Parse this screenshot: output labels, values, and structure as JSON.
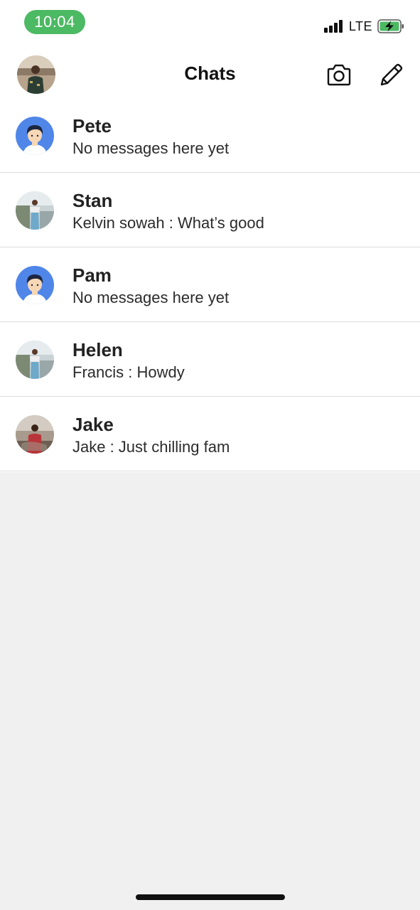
{
  "status_bar": {
    "time": "10:04",
    "network": "LTE",
    "time_pill_color": "#4cb963",
    "battery_color": "#4cb963"
  },
  "header": {
    "title": "Chats",
    "camera_icon": "camera-icon",
    "compose_icon": "pencil-icon"
  },
  "chats": [
    {
      "name": "Pete",
      "preview": "No messages here yet",
      "avatar": "default-avatar"
    },
    {
      "name": "Stan",
      "preview": "Kelvin sowah : What’s good",
      "avatar": "photo-avatar"
    },
    {
      "name": "Pam",
      "preview": "No messages here yet",
      "avatar": "default-avatar"
    },
    {
      "name": "Helen",
      "preview": "Francis : Howdy",
      "avatar": "photo-avatar"
    },
    {
      "name": "Jake",
      "preview": "Jake : Just chilling fam",
      "avatar": "photo-avatar"
    }
  ],
  "colors": {
    "default_avatar_bg": "#4f86e8",
    "list_background": "#ffffff",
    "empty_background": "#f0f0f0"
  }
}
